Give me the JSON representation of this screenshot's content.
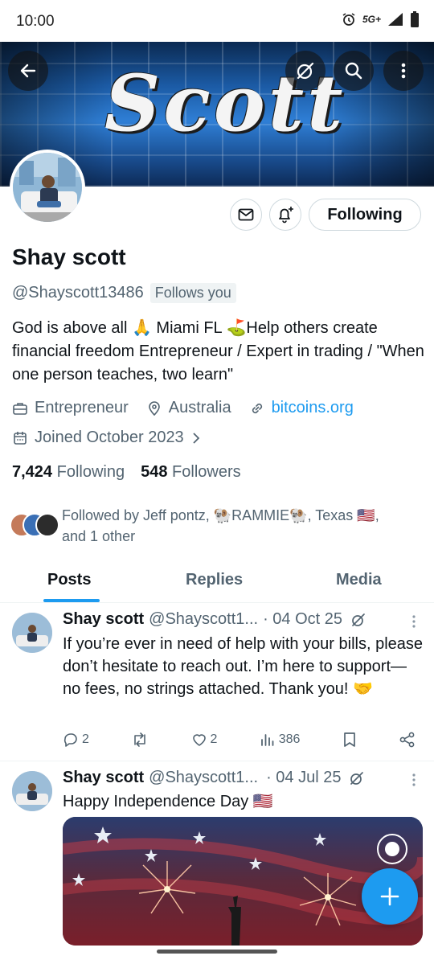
{
  "status": {
    "time": "10:00",
    "network": "5G+"
  },
  "banner": {
    "title": "Scott"
  },
  "profile": {
    "name": "Shay scott",
    "handle": "@Shayscott13486",
    "follows_you": "Follows you",
    "bio": "God is above all 🙏 Miami FL ⛳Help others create financial freedom Entrepreneur / Expert in trading / \"When one person teaches, two learn\"",
    "category": "Entrepreneur",
    "location": "Australia",
    "website": "bitcoins.org",
    "joined": "Joined October 2023",
    "following_count": "7,424",
    "following_label": "Following",
    "followers_count": "548",
    "followers_label": "Followers",
    "followed_by_line1": "Followed by Jeff pontz, 🐏RAMMIE🐏, Texas 🇺🇸,",
    "followed_by_line2": "and 1 other",
    "follow_button": "Following"
  },
  "tabs": [
    {
      "label": "Posts",
      "active": true
    },
    {
      "label": "Replies",
      "active": false
    },
    {
      "label": "Media",
      "active": false
    }
  ],
  "posts": [
    {
      "name": "Shay scott",
      "handle": "@Shayscott1...",
      "date": "· 04 Oct 25",
      "text": "If you’re ever in need of help with your bills, please don’t hesitate to reach out. I’m here to support—no fees, no strings attached. Thank you! 🤝",
      "replies": "2",
      "reposts": "",
      "likes": "2",
      "views": "386"
    },
    {
      "name": "Shay scott",
      "handle": "@Shayscott1...",
      "date": "· 04 Jul 25",
      "text": "Happy Independence Day 🇺🇸"
    }
  ],
  "colors": {
    "accent": "#1d9bf0",
    "text": "#0f1419",
    "muted": "#536471"
  },
  "icons": [
    "back-arrow-icon",
    "grok-icon",
    "search-icon",
    "more-vertical-icon",
    "mail-icon",
    "bell-plus-icon",
    "briefcase-icon",
    "location-pin-icon",
    "link-icon",
    "calendar-icon",
    "chevron-right-icon",
    "reply-icon",
    "repost-icon",
    "like-icon",
    "views-icon",
    "bookmark-icon",
    "share-icon",
    "plus-icon"
  ]
}
